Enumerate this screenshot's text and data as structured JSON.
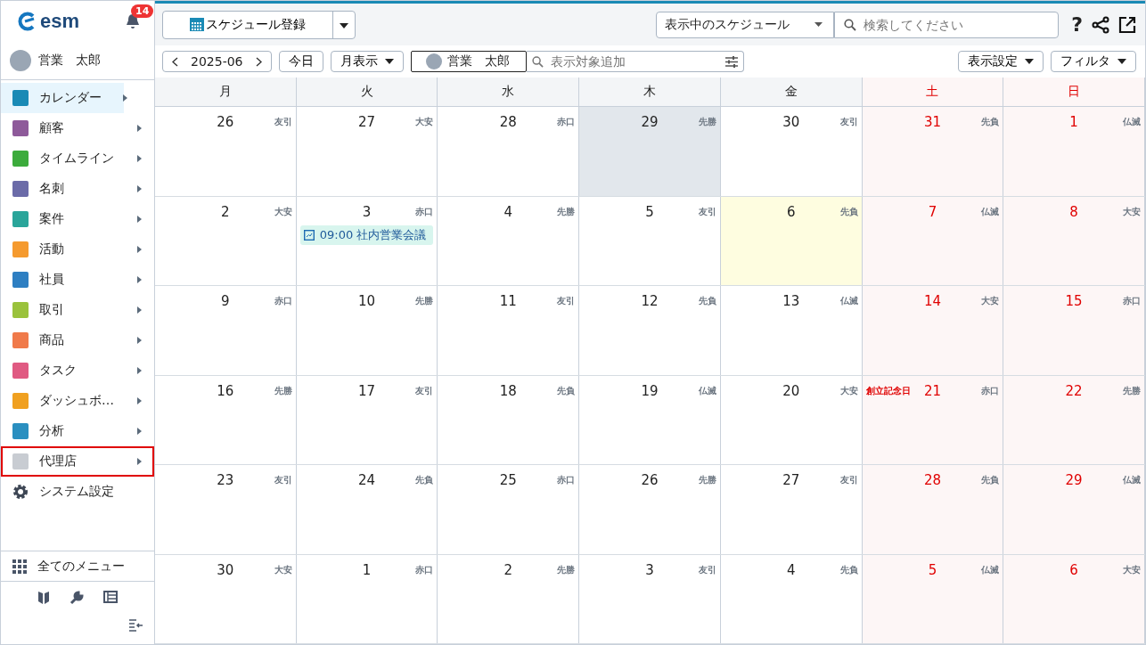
{
  "sidebar": {
    "logo": "esm",
    "notifications": "14",
    "user": "営業　太郎",
    "items": [
      {
        "label": "カレンダー",
        "selected": true,
        "highlighted": false
      },
      {
        "label": "顧客",
        "selected": false,
        "highlighted": false
      },
      {
        "label": "タイムライン",
        "selected": false,
        "highlighted": false
      },
      {
        "label": "名刺",
        "selected": false,
        "highlighted": false
      },
      {
        "label": "案件",
        "selected": false,
        "highlighted": false
      },
      {
        "label": "活動",
        "selected": false,
        "highlighted": false
      },
      {
        "label": "社員",
        "selected": false,
        "highlighted": false
      },
      {
        "label": "取引",
        "selected": false,
        "highlighted": false
      },
      {
        "label": "商品",
        "selected": false,
        "highlighted": false
      },
      {
        "label": "タスク",
        "selected": false,
        "highlighted": false
      },
      {
        "label": "ダッシュボ…",
        "selected": false,
        "highlighted": false
      },
      {
        "label": "分析",
        "selected": false,
        "highlighted": false
      },
      {
        "label": "代理店",
        "selected": false,
        "highlighted": true
      }
    ],
    "settings": "システム設定",
    "all_menu": "全てのメニュー"
  },
  "toolbar": {
    "register": "スケジュール登録",
    "scope": "表示中のスケジュール",
    "search": {
      "placeholder": "検索してください"
    },
    "help": "?"
  },
  "nav": {
    "month": "2025-06",
    "today": "今日",
    "view": "月表示",
    "user": "営業　太郎",
    "target": {
      "placeholder": "表示対象追加"
    },
    "display_settings": "表示設定",
    "filter": "フィルタ"
  },
  "weekdays": [
    {
      "label": "月",
      "weekend": false
    },
    {
      "label": "火",
      "weekend": false
    },
    {
      "label": "水",
      "weekend": false
    },
    {
      "label": "木",
      "weekend": false
    },
    {
      "label": "金",
      "weekend": false
    },
    {
      "label": "土",
      "weekend": true
    },
    {
      "label": "日",
      "weekend": true
    }
  ],
  "weeks": [
    [
      {
        "date": "26",
        "rokuyo": "友引",
        "today": false,
        "selected": false
      },
      {
        "date": "27",
        "rokuyo": "大安",
        "today": false,
        "selected": false
      },
      {
        "date": "28",
        "rokuyo": "赤口",
        "today": false,
        "selected": false
      },
      {
        "date": "29",
        "rokuyo": "先勝",
        "today": false,
        "selected": true
      },
      {
        "date": "30",
        "rokuyo": "友引",
        "today": false,
        "selected": false
      },
      {
        "date": "31",
        "rokuyo": "先負",
        "today": false,
        "selected": false
      },
      {
        "date": "1",
        "rokuyo": "仏滅",
        "today": false,
        "selected": false
      }
    ],
    [
      {
        "date": "2",
        "rokuyo": "大安",
        "today": false,
        "selected": false
      },
      {
        "date": "3",
        "rokuyo": "赤口",
        "today": false,
        "selected": false,
        "events": [
          "09:00 社内営業会議"
        ]
      },
      {
        "date": "4",
        "rokuyo": "先勝",
        "today": false,
        "selected": false
      },
      {
        "date": "5",
        "rokuyo": "友引",
        "today": false,
        "selected": false
      },
      {
        "date": "6",
        "rokuyo": "先負",
        "today": true,
        "selected": false
      },
      {
        "date": "7",
        "rokuyo": "仏滅",
        "today": false,
        "selected": false
      },
      {
        "date": "8",
        "rokuyo": "大安",
        "today": false,
        "selected": false
      }
    ],
    [
      {
        "date": "9",
        "rokuyo": "赤口",
        "today": false,
        "selected": false
      },
      {
        "date": "10",
        "rokuyo": "先勝",
        "today": false,
        "selected": false
      },
      {
        "date": "11",
        "rokuyo": "友引",
        "today": false,
        "selected": false
      },
      {
        "date": "12",
        "rokuyo": "先負",
        "today": false,
        "selected": false
      },
      {
        "date": "13",
        "rokuyo": "仏滅",
        "today": false,
        "selected": false
      },
      {
        "date": "14",
        "rokuyo": "大安",
        "today": false,
        "selected": false
      },
      {
        "date": "15",
        "rokuyo": "赤口",
        "today": false,
        "selected": false
      }
    ],
    [
      {
        "date": "16",
        "rokuyo": "先勝",
        "today": false,
        "selected": false
      },
      {
        "date": "17",
        "rokuyo": "友引",
        "today": false,
        "selected": false
      },
      {
        "date": "18",
        "rokuyo": "先負",
        "today": false,
        "selected": false
      },
      {
        "date": "19",
        "rokuyo": "仏滅",
        "today": false,
        "selected": false
      },
      {
        "date": "20",
        "rokuyo": "大安",
        "today": false,
        "selected": false
      },
      {
        "date": "21",
        "rokuyo": "赤口",
        "today": false,
        "selected": false,
        "holiday": "創立記念日"
      },
      {
        "date": "22",
        "rokuyo": "先勝",
        "today": false,
        "selected": false
      }
    ],
    [
      {
        "date": "23",
        "rokuyo": "友引",
        "today": false,
        "selected": false
      },
      {
        "date": "24",
        "rokuyo": "先負",
        "today": false,
        "selected": false
      },
      {
        "date": "25",
        "rokuyo": "赤口",
        "today": false,
        "selected": false
      },
      {
        "date": "26",
        "rokuyo": "先勝",
        "today": false,
        "selected": false
      },
      {
        "date": "27",
        "rokuyo": "友引",
        "today": false,
        "selected": false
      },
      {
        "date": "28",
        "rokuyo": "先負",
        "today": false,
        "selected": false
      },
      {
        "date": "29",
        "rokuyo": "仏滅",
        "today": false,
        "selected": false
      }
    ],
    [
      {
        "date": "30",
        "rokuyo": "大安",
        "today": false,
        "selected": false
      },
      {
        "date": "1",
        "rokuyo": "赤口",
        "today": false,
        "selected": false
      },
      {
        "date": "2",
        "rokuyo": "先勝",
        "today": false,
        "selected": false
      },
      {
        "date": "3",
        "rokuyo": "友引",
        "today": false,
        "selected": false
      },
      {
        "date": "4",
        "rokuyo": "先負",
        "today": false,
        "selected": false
      },
      {
        "date": "5",
        "rokuyo": "仏滅",
        "today": false,
        "selected": false
      },
      {
        "date": "6",
        "rokuyo": "大安",
        "today": false,
        "selected": false
      }
    ]
  ]
}
